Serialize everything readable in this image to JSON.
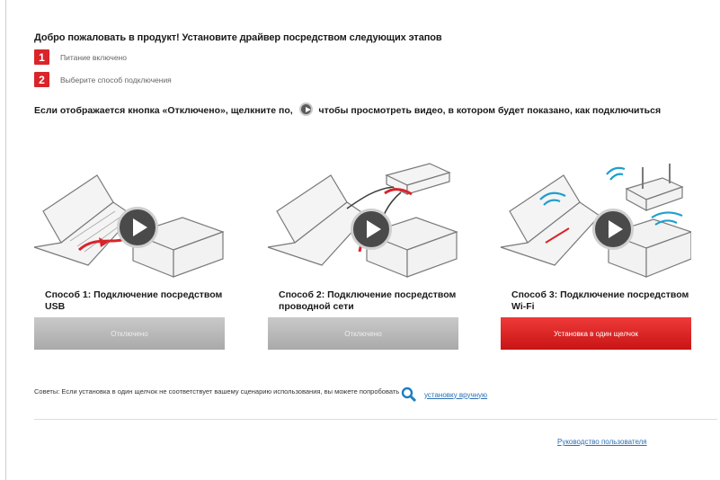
{
  "welcome": "Добро пожаловать в продукт! Установите драйвер посредством следующих этапов",
  "steps": [
    {
      "num": "1",
      "label": "Питание включено"
    },
    {
      "num": "2",
      "label": "Выберите способ подключения"
    }
  ],
  "hint_before": "Если отображается кнопка «Отключено», щелкните по,",
  "hint_after": "чтобы просмотреть видео, в котором будет показано, как подключиться",
  "methods": [
    {
      "title": "Способ 1: Подключение посредством USB",
      "button": "Отключено",
      "state": "disabled",
      "icon": "usb-connection-illustration"
    },
    {
      "title": "Способ 2: Подключение посредством проводной сети",
      "button": "Отключено",
      "state": "disabled",
      "icon": "wired-network-illustration"
    },
    {
      "title": "Способ 3: Подключение посредством Wi-Fi",
      "button": "Установка в один щелчок",
      "state": "active",
      "icon": "wifi-connection-illustration"
    }
  ],
  "tips": "Советы: Если установка в один щелчок не соответствует вашему сценарию использования, вы можете попробовать",
  "custom_install_link": "установку вручную",
  "user_guide_link": "Руководство пользователя",
  "colors": {
    "accent": "#d9242a",
    "link": "#2a6fb5",
    "disabled": "#b5b5b5"
  }
}
